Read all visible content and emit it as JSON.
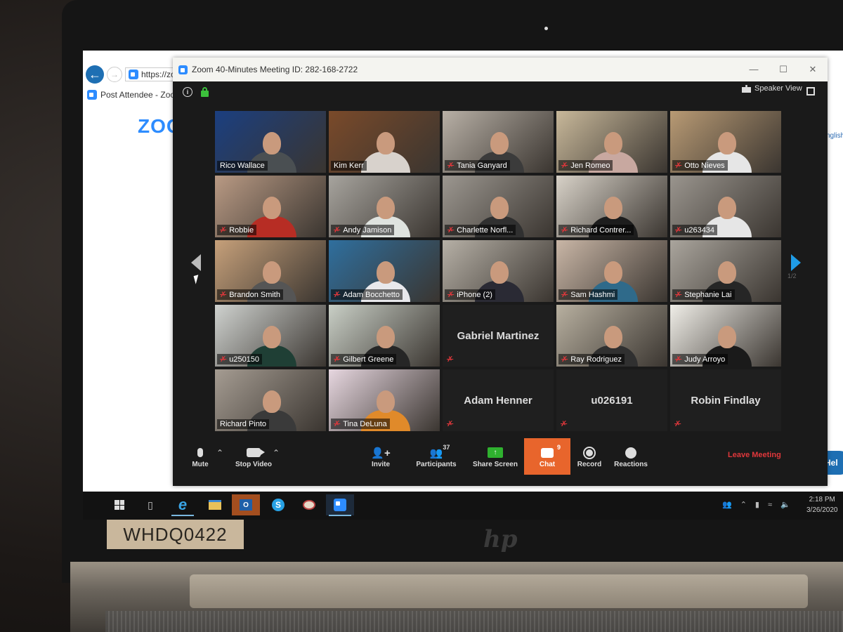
{
  "browser": {
    "url": "https://zo",
    "tab_title": "Post Attendee - Zoo",
    "logo_text": "ZOO",
    "right_text": "nglish",
    "help_label": "Hel"
  },
  "zoom_window": {
    "title": "Zoom 40-Minutes Meeting ID: 282-168-2722",
    "meeting_id": "282-168-2722",
    "speaker_view_label": "Speaker View",
    "page_indicator": "1/2",
    "participants": [
      {
        "name": "Rico Wallace",
        "muted": false,
        "video": true,
        "active": false,
        "bg": "#1b3f80",
        "shirt": "#4a4f52"
      },
      {
        "name": "Kim Kerr",
        "muted": false,
        "video": true,
        "active": true,
        "bg": "#7a4a2a",
        "shirt": "#d8d2cc"
      },
      {
        "name": "Tania Ganyard",
        "muted": true,
        "video": true,
        "active": false,
        "bg": "#b8b0a6",
        "shirt": "#3b3b3b"
      },
      {
        "name": "Jen Romeo",
        "muted": true,
        "video": true,
        "active": false,
        "bg": "#c8b89a",
        "shirt": "#c8a8a0"
      },
      {
        "name": "Otto Nieves",
        "muted": true,
        "video": true,
        "active": false,
        "bg": "#b89a74",
        "shirt": "#e6e6e6"
      },
      {
        "name": "Robbie",
        "muted": true,
        "video": true,
        "active": false,
        "bg": "#b99a84",
        "shirt": "#b72d24"
      },
      {
        "name": "Andy Jamison",
        "muted": true,
        "video": true,
        "active": false,
        "bg": "#a7a49e",
        "shirt": "#dfe3df"
      },
      {
        "name": "Charlette Norfl...",
        "muted": true,
        "video": true,
        "active": false,
        "bg": "#9c9790",
        "shirt": "#303030"
      },
      {
        "name": "Richard Contrer...",
        "muted": true,
        "video": true,
        "active": false,
        "bg": "#d8d2c8",
        "shirt": "#1d1d1d"
      },
      {
        "name": "u263434",
        "muted": true,
        "video": true,
        "active": false,
        "bg": "#9a958e",
        "shirt": "#e6e6e6"
      },
      {
        "name": "Brandon Smith",
        "muted": true,
        "video": true,
        "active": false,
        "bg": "#c6a07a",
        "shirt": "#555555"
      },
      {
        "name": "Adam Bocchetto",
        "muted": true,
        "video": true,
        "active": false,
        "bg": "#2f6f9e",
        "shirt": "#e8e8ec"
      },
      {
        "name": "iPhone (2)",
        "muted": true,
        "video": true,
        "active": false,
        "bg": "#b6b0a6",
        "shirt": "#2a2a34"
      },
      {
        "name": "Sam Hashmi",
        "muted": true,
        "video": true,
        "active": false,
        "bg": "#c9b6a6",
        "shirt": "#2f6a8a"
      },
      {
        "name": "Stephanie Lai",
        "muted": true,
        "video": true,
        "active": false,
        "bg": "#aaa59d",
        "shirt": "#262626"
      },
      {
        "name": "u250150",
        "muted": true,
        "video": true,
        "active": false,
        "bg": "#cfd2cf",
        "shirt": "#1f3f35"
      },
      {
        "name": "Gilbert Greene",
        "muted": true,
        "video": true,
        "active": false,
        "bg": "#c9cfc6",
        "shirt": "#262626"
      },
      {
        "name": "Gabriel Martinez",
        "muted": true,
        "video": false,
        "active": false
      },
      {
        "name": "Ray Rodriguez",
        "muted": true,
        "video": true,
        "active": false,
        "bg": "#b8b0a0",
        "shirt": "#303030"
      },
      {
        "name": "Judy Arroyo",
        "muted": true,
        "video": true,
        "active": false,
        "bg": "#f0eee8",
        "shirt": "#1a1a1a"
      },
      {
        "name": "Richard Pinto",
        "muted": false,
        "video": true,
        "active": false,
        "bg": "#a59c92",
        "shirt": "#3a3a3a"
      },
      {
        "name": "Tina DeLuna",
        "muted": true,
        "video": true,
        "active": false,
        "bg": "#e7d7e0",
        "shirt": "#e08a2a"
      },
      {
        "name": "Adam Henner",
        "muted": true,
        "video": false,
        "active": false
      },
      {
        "name": "u026191",
        "muted": true,
        "video": false,
        "active": false
      },
      {
        "name": "Robin Findlay",
        "muted": true,
        "video": false,
        "active": false
      }
    ]
  },
  "toolbar": {
    "mute_label": "Mute",
    "stop_video_label": "Stop Video",
    "invite_label": "Invite",
    "participants_label": "Participants",
    "participants_count": "37",
    "share_screen_label": "Share Screen",
    "chat_label": "Chat",
    "chat_count": "9",
    "record_label": "Record",
    "reactions_label": "Reactions",
    "leave_label": "Leave Meeting"
  },
  "taskbar": {
    "apps": [
      "start",
      "task-view",
      "internet-explorer",
      "file-explorer",
      "outlook",
      "skype",
      "paint",
      "zoom"
    ],
    "time": "2:18 PM",
    "date": "3/26/2020"
  },
  "physical": {
    "asset_tag": "WHDQ0422",
    "brand": "hp"
  },
  "colors": {
    "zoom_blue": "#2d8cff",
    "chat_orange": "#e8652c",
    "leave_red": "#e0373b",
    "share_green": "#2fb12f",
    "active_speaker": "#e6e24a"
  }
}
